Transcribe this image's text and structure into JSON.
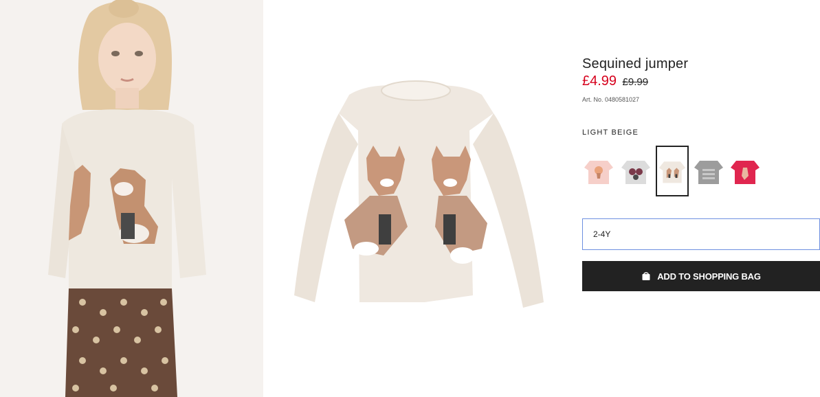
{
  "product": {
    "title": "Sequined jumper",
    "price_sale": "£4.99",
    "price_old": "£9.99",
    "article_number": "Art. No. 0480581027",
    "colour_label": "LIGHT BEIGE"
  },
  "images": {
    "model_photo": "model-photo",
    "product_photo": "product-photo"
  },
  "swatches": [
    {
      "name": "pink jumper",
      "color": "#f6cfc9",
      "selected": false
    },
    {
      "name": "grey jumper",
      "color": "#d9d9d9",
      "selected": false
    },
    {
      "name": "light beige jumper",
      "color": "#efe8e0",
      "selected": true
    },
    {
      "name": "dark grey jumper",
      "color": "#9a9a9a",
      "selected": false
    },
    {
      "name": "red jumper",
      "color": "#e0264f",
      "selected": false
    }
  ],
  "size": {
    "selected": "2-4Y"
  },
  "actions": {
    "add_to_bag": "ADD TO SHOPPING BAG"
  },
  "colors": {
    "sale_red": "#d6001c",
    "button_dark": "#222222",
    "focus_blue": "#6d8fe0"
  }
}
